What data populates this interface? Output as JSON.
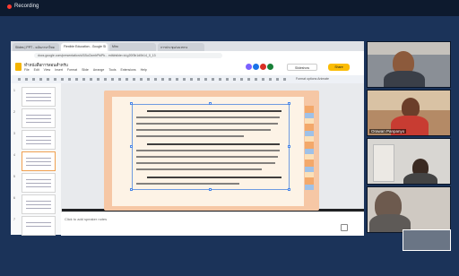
{
  "recording": {
    "label": "Recording"
  },
  "browser": {
    "tabs": [
      {
        "label": "Slides | PPT - ฉบับภาษาไทย",
        "active": false
      },
      {
        "label": "Flexible Education - Google Sl",
        "active": true
      },
      {
        "label": "Miro",
        "active": false
      },
      {
        "label": "การประชุม/แนวทาง",
        "active": false
      }
    ],
    "url": "docs.google.com/presentation/d/1BuOcmbPkiPk... edit#slide=id.g20f3b1d0b14_0_13"
  },
  "slides_app": {
    "doc_title": "ทำหนังสือการสอนสำหรับ",
    "menu": [
      "File",
      "Edit",
      "View",
      "Insert",
      "Format",
      "Slide",
      "Arrange",
      "Tools",
      "Extensions",
      "Help"
    ],
    "present_label": "Slideshow",
    "share_label": "Share",
    "toolbar_right": "Format options   Animate"
  },
  "editor": {
    "slide_numbers": [
      "1",
      "2",
      "3",
      "4",
      "5",
      "6",
      "7"
    ],
    "selected_slide": "4",
    "speaker_notes_placeholder": "Click to add speaker notes"
  },
  "participants": [
    {
      "name": ""
    },
    {
      "name": "Orawan Panpanyo"
    },
    {
      "name": ""
    },
    {
      "name": ""
    }
  ],
  "colors": {
    "brand_share": "#fbbc04",
    "slide_accent": "#f6c7a5",
    "recording_dot": "#ff3b30"
  }
}
